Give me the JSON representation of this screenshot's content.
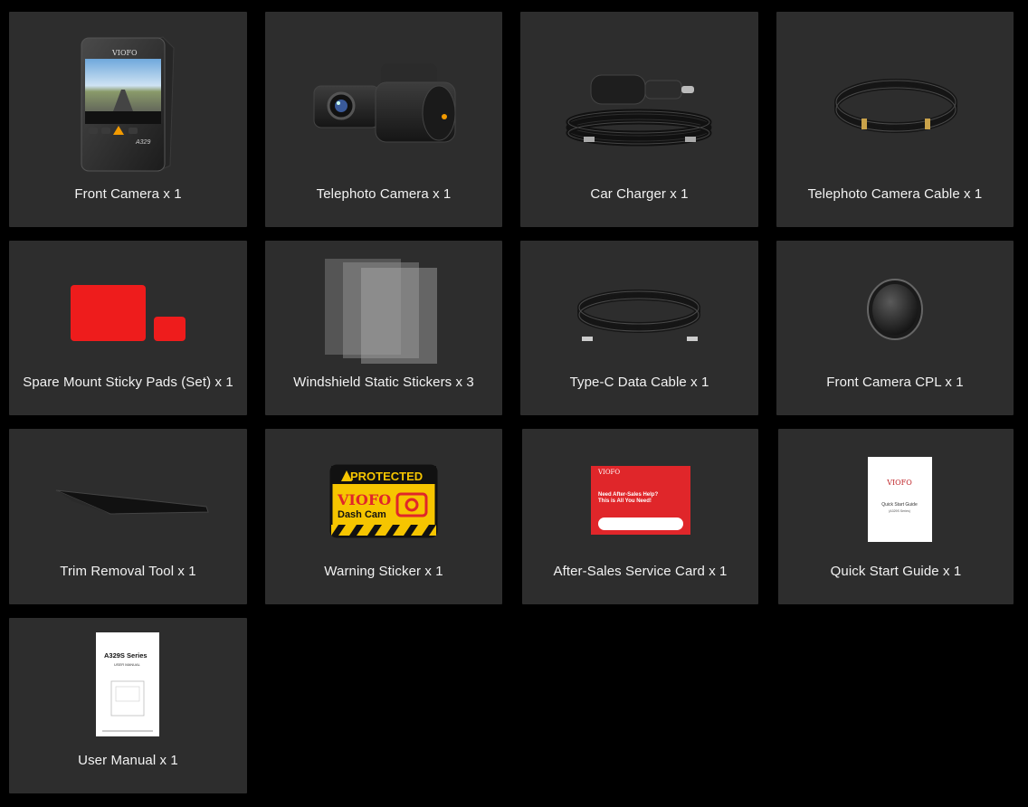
{
  "items": [
    {
      "label": "Front Camera x 1"
    },
    {
      "label": "Telephoto Camera x 1"
    },
    {
      "label": "Car Charger x 1"
    },
    {
      "label": "Telephoto Camera Cable x 1"
    },
    {
      "label": "Spare Mount Sticky Pads (Set) x 1"
    },
    {
      "label": "Windshield Static Stickers x 3"
    },
    {
      "label": "Type-C Data Cable x 1"
    },
    {
      "label": "Front Camera CPL x 1"
    },
    {
      "label": "Trim Removal Tool x 1"
    },
    {
      "label": "Warning Sticker x 1"
    },
    {
      "label": "After-Sales Service Card x 1"
    },
    {
      "label": "Quick Start Guide x 1"
    },
    {
      "label": "User Manual x 1"
    }
  ],
  "product_text": {
    "brand": "VIOFO",
    "camera_model": "A329",
    "sticker_top": "PROTECTED",
    "sticker_brand": "VIOFO",
    "sticker_sub": "Dash Cam",
    "card_brand": "VIOFO",
    "card_line1": "Need After-Sales Help?",
    "card_line2": "This is All You Need!",
    "guide_brand": "VIOFO",
    "guide_title": "Quick Start Guide",
    "guide_sub": "(A329S Series)",
    "manual_series": "A329S Series",
    "manual_title": "USER MANUAL"
  },
  "colors": {
    "card_bg": "#2d2d2d",
    "page_bg": "#000000",
    "pad_red": "#ee1c1c",
    "sticker_yellow": "#f6c500",
    "card_red": "#e0262a"
  }
}
